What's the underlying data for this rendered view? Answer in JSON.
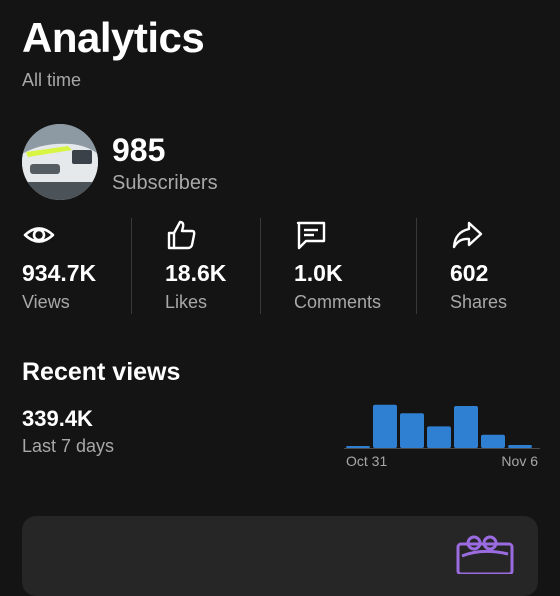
{
  "header": {
    "title": "Analytics",
    "subtitle": "All time"
  },
  "channel": {
    "subscriber_count": "985",
    "subscriber_label": "Subscribers"
  },
  "stats": [
    {
      "icon": "eye-icon",
      "value": "934.7K",
      "label": "Views"
    },
    {
      "icon": "thumbs-up-icon",
      "value": "18.6K",
      "label": "Likes"
    },
    {
      "icon": "comment-icon",
      "value": "1.0K",
      "label": "Comments"
    },
    {
      "icon": "share-arrow-icon",
      "value": "602",
      "label": "Shares"
    }
  ],
  "recent": {
    "title": "Recent views",
    "value": "339.4K",
    "period_label": "Last 7 days"
  },
  "chart_data": {
    "type": "bar",
    "categories": [
      "",
      "Oct 31",
      "",
      "",
      "",
      "",
      "",
      "Nov 6"
    ],
    "x_tick_labels": [
      "Oct 31",
      "Nov 6"
    ],
    "values": [
      3,
      72,
      58,
      36,
      70,
      22,
      5
    ],
    "color": "#2f7fd3"
  },
  "colors": {
    "background": "#141414",
    "accent_bar": "#2f7fd3",
    "promo": "#9b6be0"
  }
}
